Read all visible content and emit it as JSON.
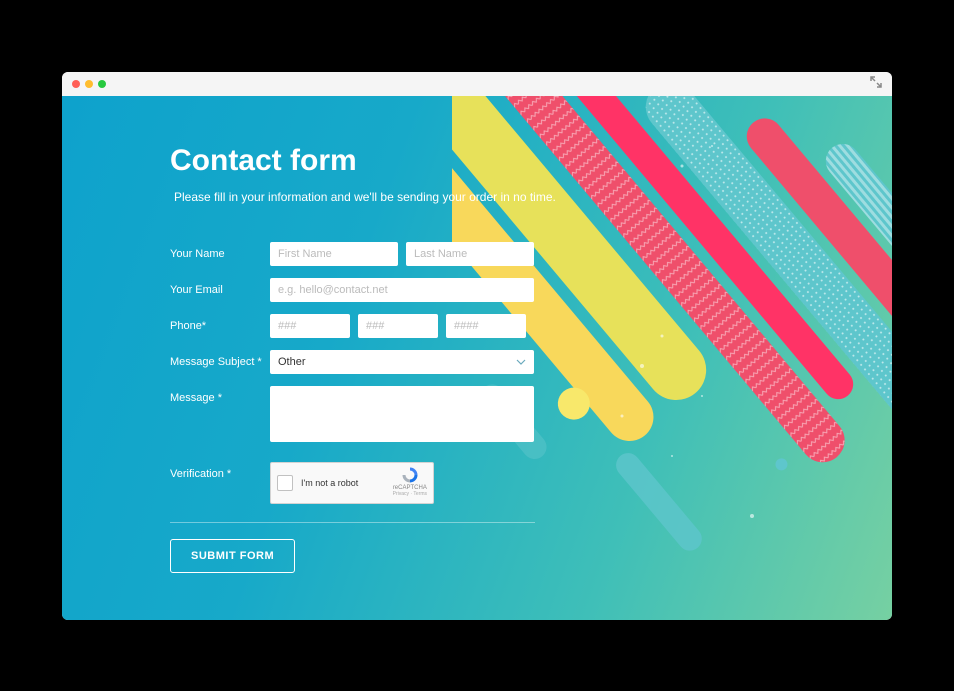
{
  "page": {
    "heading": "Contact form",
    "subheading": "Please fill in your information and we'll be sending your order in no time."
  },
  "form": {
    "name": {
      "label": "Your Name",
      "first_ph": "First Name",
      "last_ph": "Last Name"
    },
    "email": {
      "label": "Your Email",
      "ph": "e.g. hello@contact.net"
    },
    "phone": {
      "label": "Phone*",
      "p1_ph": "###",
      "p2_ph": "###",
      "p3_ph": "####"
    },
    "subject": {
      "label": "Message Subject *",
      "value": "Other"
    },
    "message": {
      "label": "Message *"
    },
    "verification": {
      "label": "Verification *",
      "captcha_text": "I'm not a robot",
      "captcha_brand": "reCAPTCHA",
      "captcha_terms": "Privacy · Terms"
    },
    "submit": "SUBMIT FORM"
  }
}
